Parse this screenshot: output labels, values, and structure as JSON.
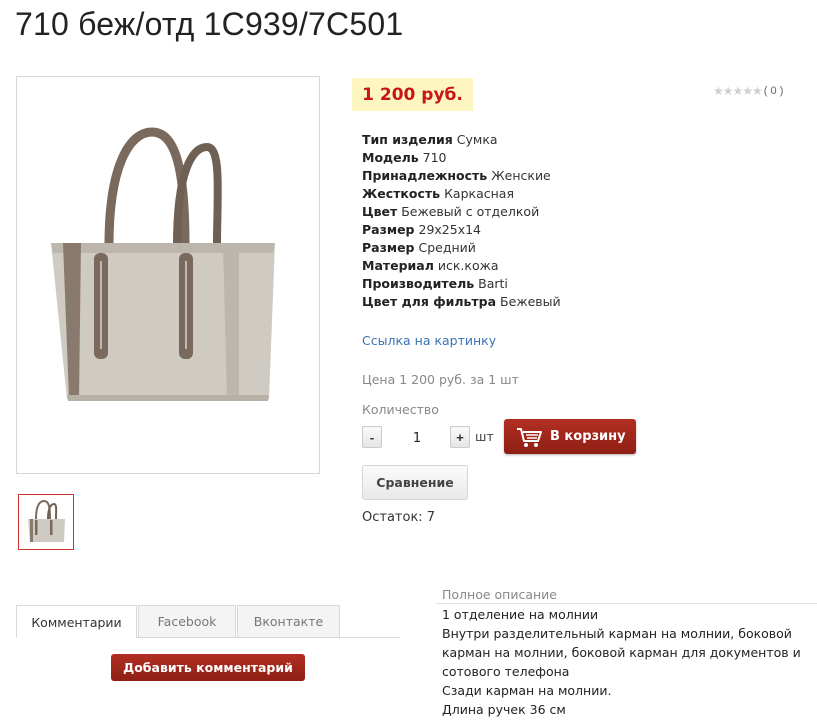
{
  "product": {
    "title": "710 беж/отд 1C939/7C501",
    "price": "1 200 руб.",
    "rating_count": "( 0 )",
    "stars": "★★★★★",
    "properties": [
      {
        "name": "Тип изделия",
        "value": "Сумка"
      },
      {
        "name": "Модель",
        "value": "710"
      },
      {
        "name": "Принадлежность",
        "value": "Женские"
      },
      {
        "name": "Жесткость",
        "value": "Каркасная"
      },
      {
        "name": "Цвет",
        "value": "Бежевый с отделкой"
      },
      {
        "name": "Размер",
        "value": "29x25x14"
      },
      {
        "name": "Размер",
        "value": "Средний"
      },
      {
        "name": "Материал",
        "value": "иск.кожа"
      },
      {
        "name": "Производитель",
        "value": "Barti"
      },
      {
        "name": "Цвет для фильтра",
        "value": "Бежевый"
      }
    ],
    "image_link": "Ссылка на картинку",
    "unit_price": "Цена 1 200 руб. за 1 шт",
    "quantity_label": "Количество",
    "quantity": "1",
    "minus": "-",
    "plus": "+",
    "unit": "шт",
    "cart_button": "В корзину",
    "compare_button": "Сравнение",
    "stock": "Остаток: 7"
  },
  "tabs": [
    {
      "label": "Комментарии",
      "active": true
    },
    {
      "label": "Facebook",
      "active": false
    },
    {
      "label": "Вконтакте",
      "active": false
    }
  ],
  "comment_button": "Добавить комментарий",
  "description": {
    "label": "Полное описание",
    "lines": [
      "1 отделение на молнии",
      "Внутри разделительный карман на молнии, боковой карман на молнии, боковой карман для документов и сотового телефона",
      "Сзади карман на молнии.",
      "Длина ручек 36 см"
    ]
  },
  "colors": {
    "price": "#c8151b",
    "price_bg": "#fdf6c0",
    "accent_button": "#a0261b",
    "link": "#3a73b5"
  }
}
